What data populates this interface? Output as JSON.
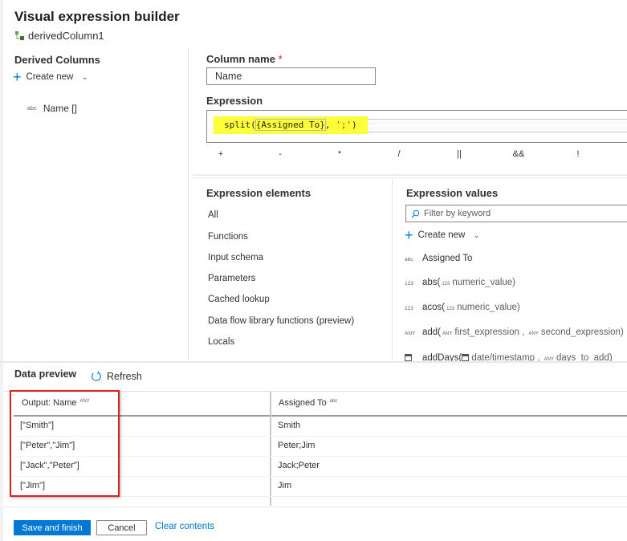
{
  "header": {
    "title": "Visual expression builder",
    "subtitle": "derivedColumn1"
  },
  "derived_columns": {
    "title": "Derived Columns",
    "create_new_label": "Create new",
    "items": [
      {
        "type_tag": "abc",
        "label": "Name []"
      }
    ]
  },
  "column_name": {
    "label": "Column name",
    "required_mark": "*",
    "value": "Name"
  },
  "expression": {
    "label": "Expression",
    "code_prefix": "split(",
    "code_bracket": "{Assigned To}",
    "code_mid": ", ",
    "code_string": "';'",
    "code_suffix": ")"
  },
  "operators": [
    "+",
    "-",
    "*",
    "/",
    "||",
    "&&",
    "!"
  ],
  "expression_elements": {
    "title": "Expression elements",
    "items": [
      "All",
      "Functions",
      "Input schema",
      "Parameters",
      "Cached lookup",
      "Data flow library functions (preview)",
      "Locals"
    ]
  },
  "expression_values": {
    "title": "Expression values",
    "filter_placeholder": "Filter by keyword",
    "create_new_label": "Create new",
    "items": [
      {
        "tag": "abc",
        "name": "Assigned To"
      },
      {
        "tag": "123",
        "name": "abs(",
        "p1tag": "123",
        "p1": "numeric_value)"
      },
      {
        "tag": "123",
        "name": "acos(",
        "p1tag": "123",
        "p1": "numeric_value)"
      },
      {
        "tag": "ANY",
        "name": "add(",
        "p1tag": "ANY",
        "p1": "first_expression ,",
        "p2tag": "ANY",
        "p2": "second_expression)"
      },
      {
        "tag": "calendar",
        "name": "addDays(",
        "p1tag": "calendar",
        "p1": "date/timestamp ,",
        "p2tag": "ANY",
        "p2": "days_to_add)"
      }
    ]
  },
  "data_preview": {
    "title": "Data preview",
    "refresh_label": "Refresh",
    "columns": [
      {
        "label": "Output: Name",
        "type_tag": "ANY"
      },
      {
        "label": "Assigned To",
        "type_tag": "abc"
      }
    ],
    "rows": [
      [
        "[\"Smith\"]",
        "Smith"
      ],
      [
        "[\"Peter\",\"Jim\"]",
        "Peter;Jim"
      ],
      [
        "[\"Jack\",\"Peter\"]",
        "Jack;Peter"
      ],
      [
        "[\"Jim\"]",
        "Jim"
      ]
    ]
  },
  "footer": {
    "save_label": "Save and finish",
    "cancel_label": "Cancel",
    "clear_label": "Clear contents"
  },
  "colors": {
    "accent": "#0078d4",
    "highlight": "#ffff3a",
    "annotation_box": "#e02020"
  }
}
